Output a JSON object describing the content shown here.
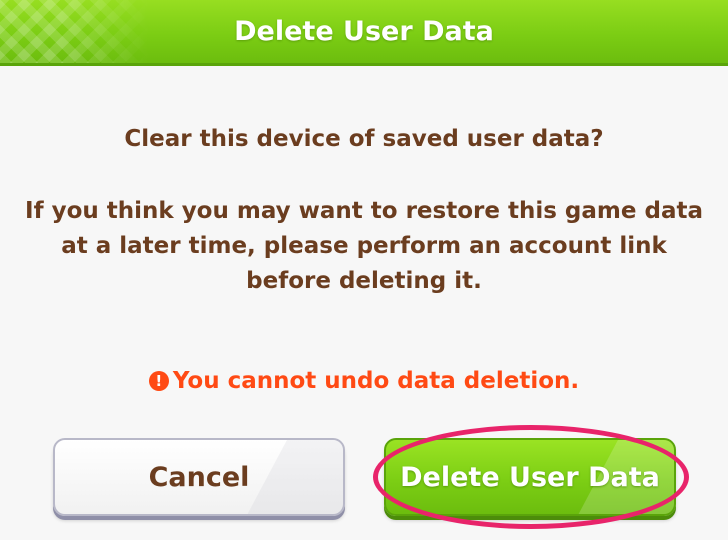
{
  "dialog": {
    "title": "Delete User Data",
    "question": "Clear this device of saved user data?",
    "info_text": "If you think you may want to restore this game data at a later time, please perform an account link before deleting it.",
    "warning_icon": "alert-circle-icon",
    "warning_glyph": "!",
    "warning_text": "You cannot undo data deletion.",
    "cancel_label": "Cancel",
    "delete_label": "Delete User Data"
  },
  "colors": {
    "header_green": "#7ccd14",
    "text_brown": "#6b3d1f",
    "warning_orange": "#ff4a14",
    "highlight_pink": "#e8246a"
  }
}
